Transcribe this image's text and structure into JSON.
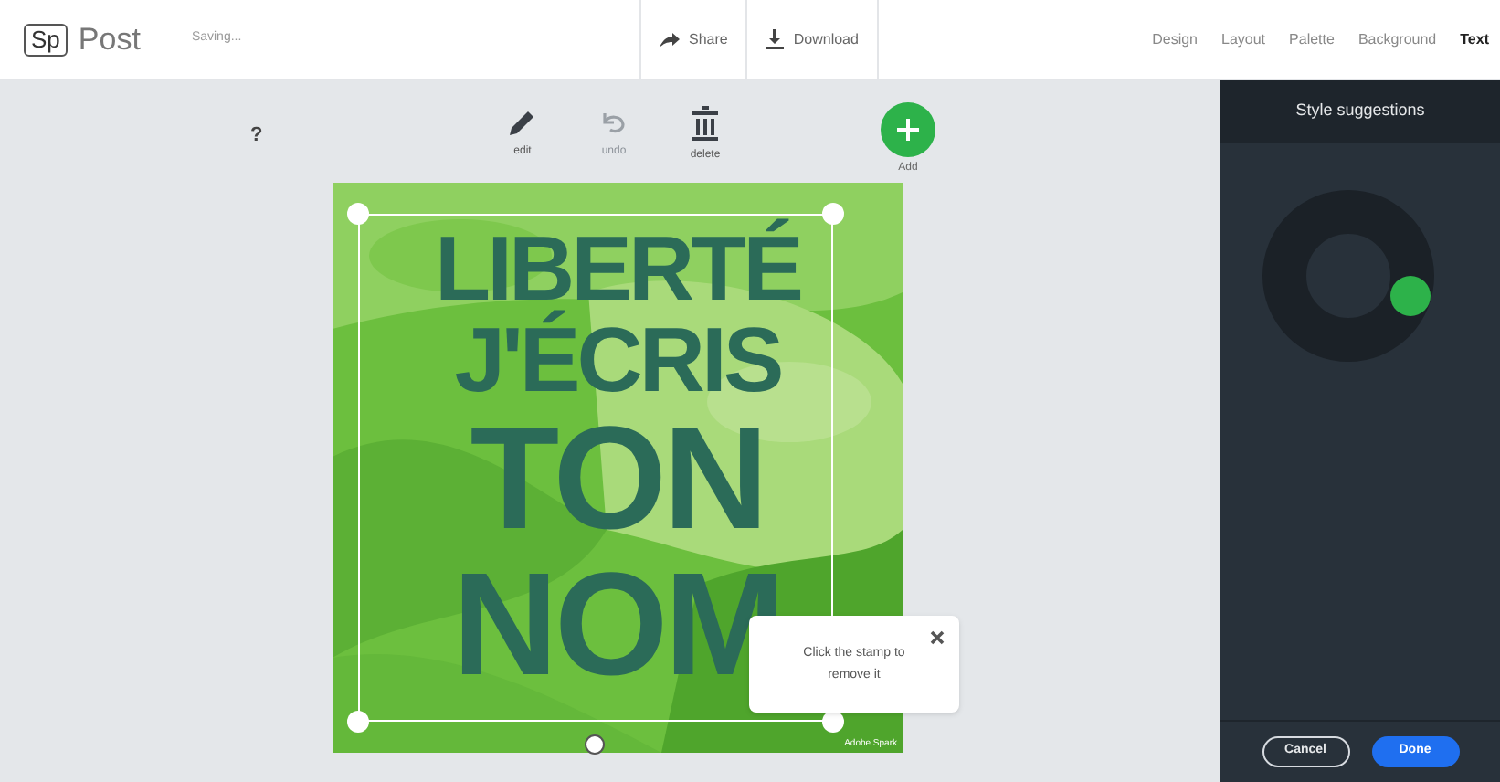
{
  "app": {
    "logo": "Sp",
    "title": "Post",
    "status": "Saving..."
  },
  "actions": [
    {
      "label": "Share",
      "kind": "share"
    },
    {
      "label": "Download",
      "kind": "download"
    }
  ],
  "tabs": [
    {
      "label": "Design",
      "selected": false
    },
    {
      "label": "Layout",
      "selected": false
    },
    {
      "label": "Palette",
      "selected": false
    },
    {
      "label": "Background",
      "selected": false
    },
    {
      "label": "Text",
      "selected": true
    }
  ],
  "toolbar": {
    "help": "?",
    "tools": [
      {
        "label": "edit",
        "kind": "edit",
        "disabled": false
      },
      {
        "label": "undo",
        "kind": "undo",
        "disabled": true
      },
      {
        "label": "delete",
        "kind": "delete",
        "disabled": false
      },
      {
        "label": "Add",
        "kind": "add",
        "disabled": false
      }
    ]
  },
  "poster": {
    "lines": [
      {
        "text": "LIBERTÉ",
        "kind": "small"
      },
      {
        "text": "J'ÉCRIS",
        "kind": "small"
      },
      {
        "text": "TON",
        "kind": "large"
      },
      {
        "text": "NOM",
        "kind": "large"
      }
    ],
    "stamp": "Adobe Spark"
  },
  "tooltip": {
    "text": "Click the stamp to remove it"
  },
  "panel": {
    "title": "Style suggestions",
    "buttons": [
      {
        "label": "Cancel",
        "kind": "secondary"
      },
      {
        "label": "Done",
        "kind": "primary"
      }
    ]
  }
}
